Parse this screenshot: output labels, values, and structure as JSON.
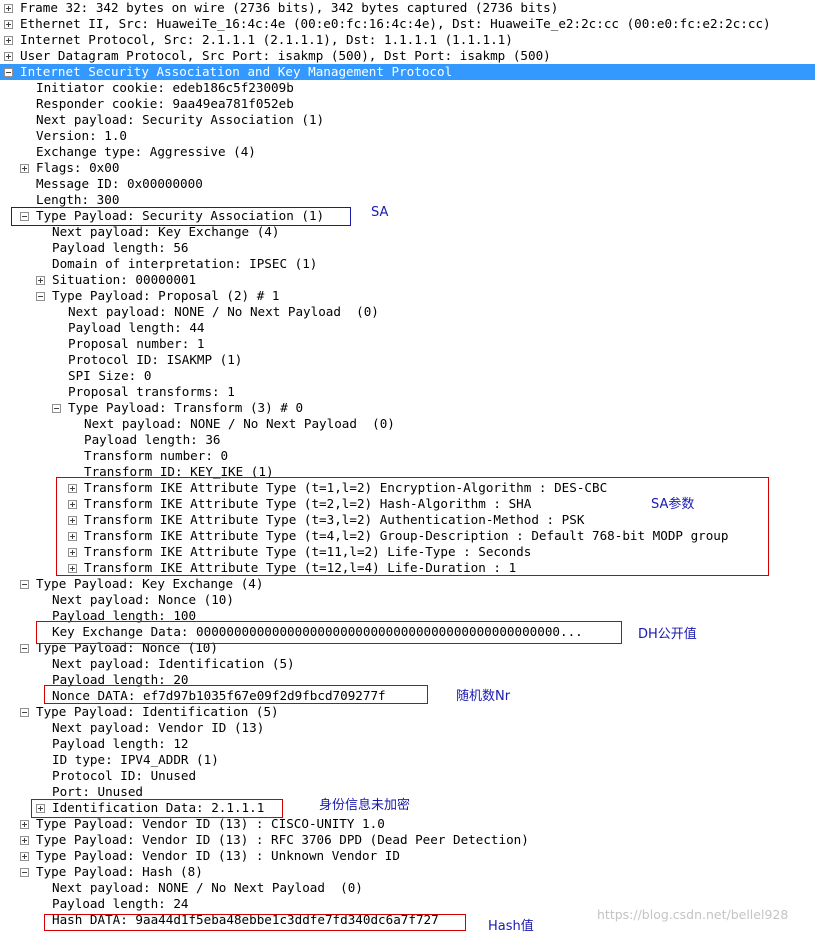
{
  "rows": [
    {
      "text": "Frame 32: 342 bytes on wire (2736 bits), 342 bytes captured (2736 bits)",
      "toggle": "plus"
    },
    {
      "text": "Ethernet II, Src: HuaweiTe_16:4c:4e (00:e0:fc:16:4c:4e), Dst: HuaweiTe_e2:2c:cc (00:e0:fc:e2:2c:cc)",
      "toggle": "plus"
    },
    {
      "text": "Internet Protocol, Src: 2.1.1.1 (2.1.1.1), Dst: 1.1.1.1 (1.1.1.1)",
      "toggle": "plus"
    },
    {
      "text": "User Datagram Protocol, Src Port: isakmp (500), Dst Port: isakmp (500)",
      "toggle": "plus"
    },
    {
      "text": "Internet Security Association and Key Management Protocol",
      "toggle": "minus",
      "selected": true
    },
    {
      "text": "Initiator cookie: edeb186c5f23009b",
      "toggle": ""
    },
    {
      "text": "Responder cookie: 9aa49ea781f052eb",
      "toggle": ""
    },
    {
      "text": "Next payload: Security Association (1)",
      "toggle": ""
    },
    {
      "text": "Version: 1.0",
      "toggle": ""
    },
    {
      "text": "Exchange type: Aggressive (4)",
      "toggle": ""
    },
    {
      "text": "Flags: 0x00",
      "toggle": "plus"
    },
    {
      "text": "Message ID: 0x00000000",
      "toggle": ""
    },
    {
      "text": "Length: 300",
      "toggle": ""
    },
    {
      "text": "Type Payload: Security Association (1)",
      "toggle": "minus"
    },
    {
      "text": "Next payload: Key Exchange (4)",
      "toggle": ""
    },
    {
      "text": "Payload length: 56",
      "toggle": ""
    },
    {
      "text": "Domain of interpretation: IPSEC (1)",
      "toggle": ""
    },
    {
      "text": "Situation: 00000001",
      "toggle": "plus"
    },
    {
      "text": "Type Payload: Proposal (2) # 1",
      "toggle": "minus"
    },
    {
      "text": "Next payload: NONE / No Next Payload  (0)",
      "toggle": ""
    },
    {
      "text": "Payload length: 44",
      "toggle": ""
    },
    {
      "text": "Proposal number: 1",
      "toggle": ""
    },
    {
      "text": "Protocol ID: ISAKMP (1)",
      "toggle": ""
    },
    {
      "text": "SPI Size: 0",
      "toggle": ""
    },
    {
      "text": "Proposal transforms: 1",
      "toggle": ""
    },
    {
      "text": "Type Payload: Transform (3) # 0",
      "toggle": "minus"
    },
    {
      "text": "Next payload: NONE / No Next Payload  (0)",
      "toggle": ""
    },
    {
      "text": "Payload length: 36",
      "toggle": ""
    },
    {
      "text": "Transform number: 0",
      "toggle": ""
    },
    {
      "text": "Transform ID: KEY_IKE (1)",
      "toggle": ""
    },
    {
      "text": "Transform IKE Attribute Type (t=1,l=2) Encryption-Algorithm : DES-CBC",
      "toggle": "plus"
    },
    {
      "text": "Transform IKE Attribute Type (t=2,l=2) Hash-Algorithm : SHA",
      "toggle": "plus"
    },
    {
      "text": "Transform IKE Attribute Type (t=3,l=2) Authentication-Method : PSK",
      "toggle": "plus"
    },
    {
      "text": "Transform IKE Attribute Type (t=4,l=2) Group-Description : Default 768-bit MODP group",
      "toggle": "plus"
    },
    {
      "text": "Transform IKE Attribute Type (t=11,l=2) Life-Type : Seconds",
      "toggle": "plus"
    },
    {
      "text": "Transform IKE Attribute Type (t=12,l=4) Life-Duration : 1",
      "toggle": "plus"
    },
    {
      "text": "Type Payload: Key Exchange (4)",
      "toggle": "minus"
    },
    {
      "text": "Next payload: Nonce (10)",
      "toggle": ""
    },
    {
      "text": "Payload length: 100",
      "toggle": ""
    },
    {
      "text": "Key Exchange Data: 000000000000000000000000000000000000000000000000...",
      "toggle": ""
    },
    {
      "text": "Type Payload: Nonce (10)",
      "toggle": "minus"
    },
    {
      "text": "Next payload: Identification (5)",
      "toggle": ""
    },
    {
      "text": "Payload length: 20",
      "toggle": ""
    },
    {
      "text": "Nonce DATA: ef7d97b1035f67e09f2d9fbcd709277f",
      "toggle": ""
    },
    {
      "text": "Type Payload: Identification (5)",
      "toggle": "minus"
    },
    {
      "text": "Next payload: Vendor ID (13)",
      "toggle": ""
    },
    {
      "text": "Payload length: 12",
      "toggle": ""
    },
    {
      "text": "ID type: IPV4_ADDR (1)",
      "toggle": ""
    },
    {
      "text": "Protocol ID: Unused",
      "toggle": ""
    },
    {
      "text": "Port: Unused",
      "toggle": ""
    },
    {
      "text": "Identification Data: 2.1.1.1",
      "toggle": "plus"
    },
    {
      "text": "Type Payload: Vendor ID (13) : CISCO-UNITY 1.0",
      "toggle": "plus"
    },
    {
      "text": "Type Payload: Vendor ID (13) : RFC 3706 DPD (Dead Peer Detection)",
      "toggle": "plus"
    },
    {
      "text": "Type Payload: Vendor ID (13) : Unknown Vendor ID",
      "toggle": "plus"
    },
    {
      "text": "Type Payload: Hash (8)",
      "toggle": "minus"
    },
    {
      "text": "Next payload: NONE / No Next Payload  (0)",
      "toggle": ""
    },
    {
      "text": "Payload length: 24",
      "toggle": ""
    },
    {
      "text": "Hash DATA: 9aa44d1f5eba48ebbe1c3ddfe7fd340dc6a7f727",
      "toggle": ""
    }
  ],
  "annotations": {
    "sa": "SA",
    "sa_params": "SA参数",
    "dh": "DH公开值",
    "nonce": "随机数Nr",
    "identity": "身份信息未加密",
    "hash": "Hash值"
  },
  "watermark": "https://blog.csdn.net/bellel928",
  "colors": {
    "selection": "#3399ff",
    "highlight_box": "#d40000",
    "sa_box": "#1a1aa6",
    "annotation": "#1a1ab0"
  }
}
